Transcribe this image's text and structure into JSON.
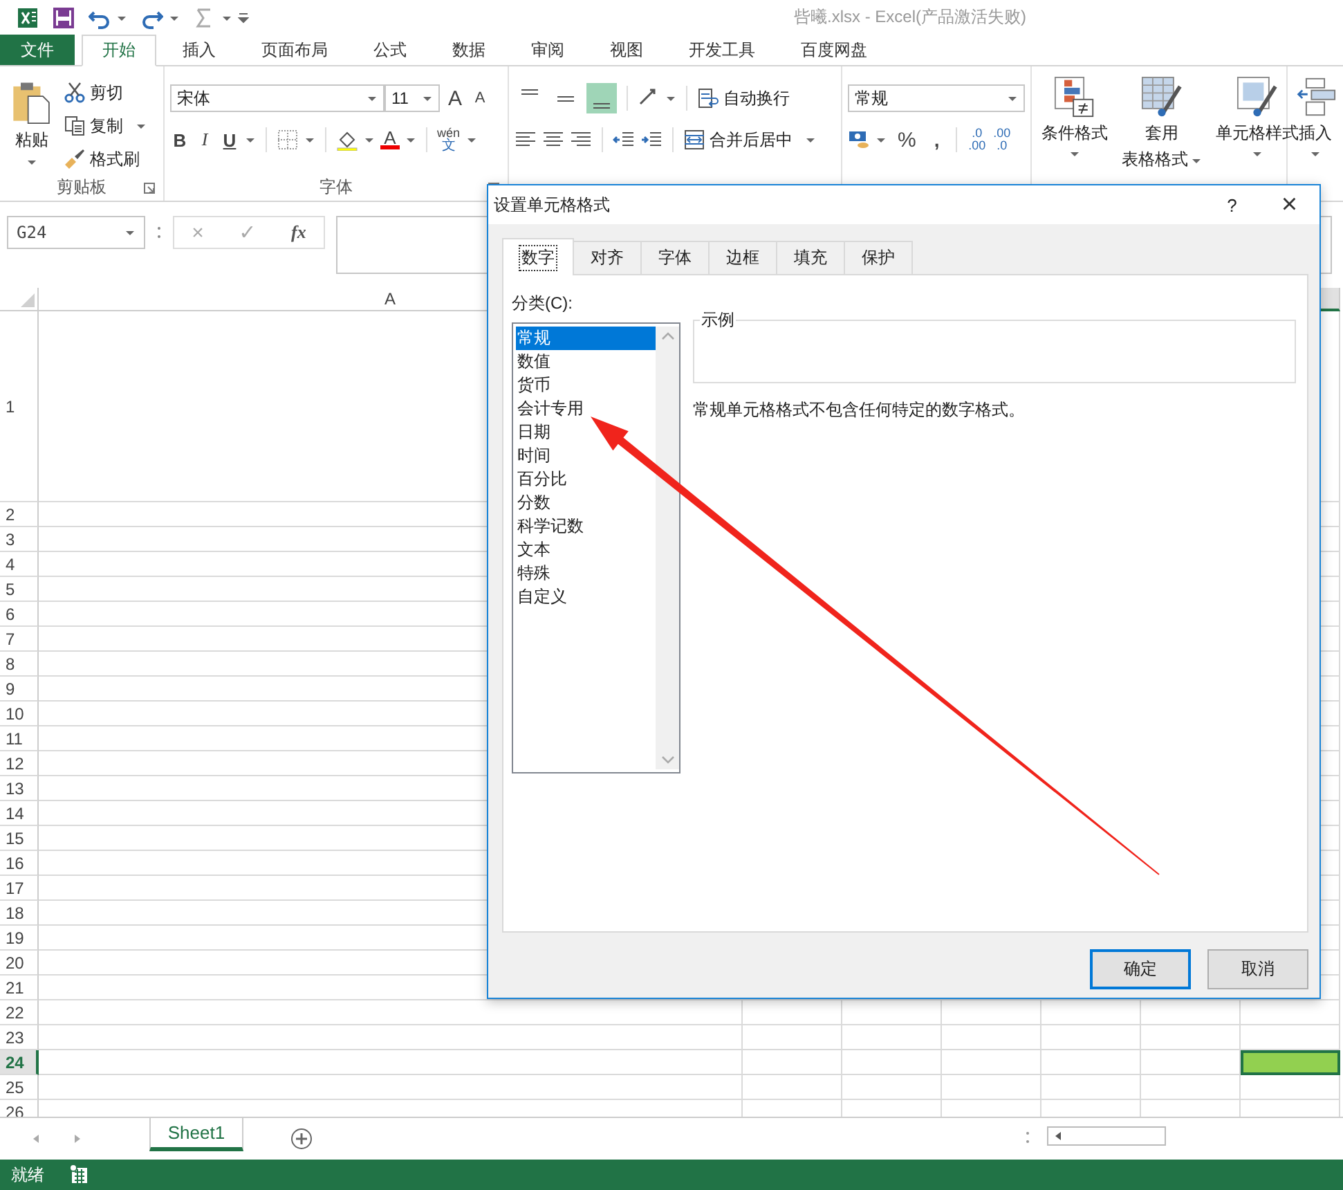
{
  "title_bar": {
    "title": "呰曦.xlsx - Excel(产品激活失败)"
  },
  "ribbon_tabs": [
    {
      "label": "文件",
      "kind": "file",
      "selected": false
    },
    {
      "label": "开始",
      "kind": "tab",
      "selected": true
    },
    {
      "label": "插入",
      "kind": "tab",
      "selected": false
    },
    {
      "label": "页面布局",
      "kind": "tab",
      "selected": false
    },
    {
      "label": "公式",
      "kind": "tab",
      "selected": false
    },
    {
      "label": "数据",
      "kind": "tab",
      "selected": false
    },
    {
      "label": "审阅",
      "kind": "tab",
      "selected": false
    },
    {
      "label": "视图",
      "kind": "tab",
      "selected": false
    },
    {
      "label": "开发工具",
      "kind": "tab",
      "selected": false
    },
    {
      "label": "百度网盘",
      "kind": "tab",
      "selected": false
    }
  ],
  "clipboard": {
    "paste": "粘贴",
    "cut": "剪切",
    "copy": "复制",
    "format_painter": "格式刷",
    "group_label": "剪贴板"
  },
  "font": {
    "name": "宋体",
    "size": "11",
    "grow": "A",
    "shrink": "A",
    "bold": "B",
    "italic": "I",
    "underline": "U",
    "font_color": "A",
    "phonetic_top": "wén",
    "phonetic_bottom": "文",
    "group_label": "字体"
  },
  "alignment": {
    "vertical": [
      {
        "selected": false
      },
      {
        "selected": false
      },
      {
        "selected": true
      }
    ],
    "wrap_text": "自动换行",
    "merge_center": "合并后居中"
  },
  "number": {
    "format": "常规",
    "percent": "%",
    "comma": ",",
    "increase_decimal": {
      "top": ".0",
      "bottom": ".00"
    },
    "decrease_decimal": {
      "top": ".00",
      "bottom": ".0"
    }
  },
  "styles": [
    {
      "kind": "conditional",
      "label": "条件格式"
    },
    {
      "kind": "table",
      "label": "套用",
      "label2": "表格格式"
    },
    {
      "kind": "cell",
      "label": "单元格样式"
    }
  ],
  "cells": {
    "insert": "插入"
  },
  "formula_bar": {
    "name_box": "G24",
    "cancel": "×",
    "enter": "✓",
    "fx": "fx"
  },
  "sheet": {
    "column_header": "A",
    "rows": [
      {
        "number": "1",
        "selected": false
      },
      {
        "number": "2",
        "selected": false
      },
      {
        "number": "3",
        "selected": false
      },
      {
        "number": "4",
        "selected": false
      },
      {
        "number": "5",
        "selected": false
      },
      {
        "number": "6",
        "selected": false
      },
      {
        "number": "7",
        "selected": false
      },
      {
        "number": "8",
        "selected": false
      },
      {
        "number": "9",
        "selected": false
      },
      {
        "number": "10",
        "selected": false
      },
      {
        "number": "11",
        "selected": false
      },
      {
        "number": "12",
        "selected": false
      },
      {
        "number": "13",
        "selected": false
      },
      {
        "number": "14",
        "selected": false
      },
      {
        "number": "15",
        "selected": false
      },
      {
        "number": "16",
        "selected": false
      },
      {
        "number": "17",
        "selected": false
      },
      {
        "number": "18",
        "selected": false
      },
      {
        "number": "19",
        "selected": false
      },
      {
        "number": "20",
        "selected": false
      },
      {
        "number": "21",
        "selected": false
      },
      {
        "number": "22",
        "selected": false
      },
      {
        "number": "23",
        "selected": false
      },
      {
        "number": "24",
        "selected": true
      },
      {
        "number": "25",
        "selected": false
      },
      {
        "number": "26",
        "selected": false
      }
    ]
  },
  "sheet_tabs": [
    {
      "label": "Sheet1",
      "selected": true
    }
  ],
  "status_bar": {
    "text": "就绪"
  },
  "dialog": {
    "title": "设置单元格格式",
    "help": "?",
    "close": "×",
    "tabs": [
      {
        "label": "数字",
        "selected": true
      },
      {
        "label": "对齐",
        "selected": false
      },
      {
        "label": "字体",
        "selected": false
      },
      {
        "label": "边框",
        "selected": false
      },
      {
        "label": "填充",
        "selected": false
      },
      {
        "label": "保护",
        "selected": false
      }
    ],
    "category_label": "分类(C):",
    "categories": [
      {
        "label": "常规",
        "selected": true
      },
      {
        "label": "数值",
        "selected": false
      },
      {
        "label": "货币",
        "selected": false
      },
      {
        "label": "会计专用",
        "selected": false
      },
      {
        "label": "日期",
        "selected": false
      },
      {
        "label": "时间",
        "selected": false
      },
      {
        "label": "百分比",
        "selected": false
      },
      {
        "label": "分数",
        "selected": false
      },
      {
        "label": "科学记数",
        "selected": false
      },
      {
        "label": "文本",
        "selected": false
      },
      {
        "label": "特殊",
        "selected": false
      },
      {
        "label": "自定义",
        "selected": false
      }
    ],
    "sample_label": "示例",
    "description": "常规单元格格式不包含任何特定的数字格式。",
    "buttons": [
      {
        "label": "确定",
        "kind": "default"
      },
      {
        "label": "取消",
        "kind": "normal"
      }
    ]
  }
}
